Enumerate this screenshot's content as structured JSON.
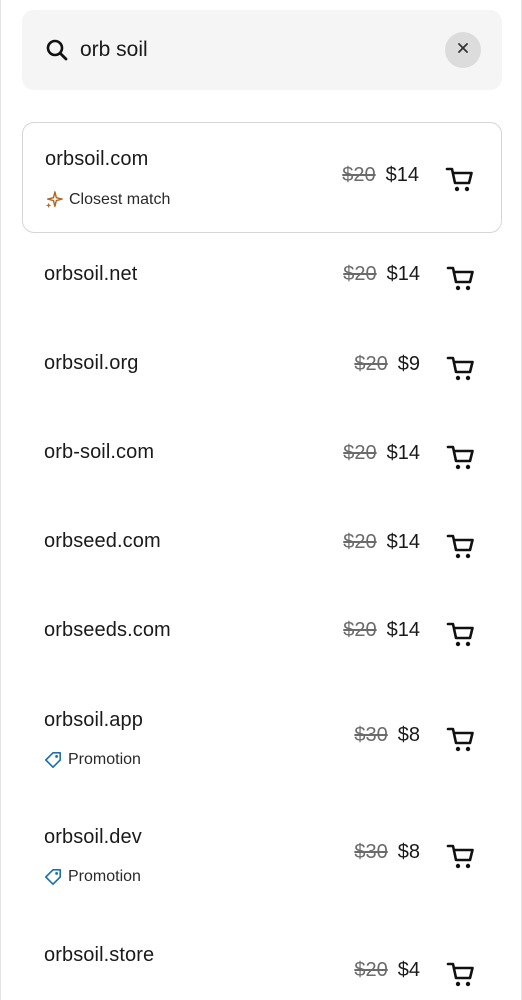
{
  "search": {
    "value": "orb soil"
  },
  "results": [
    {
      "domain": "orbsoil.com",
      "old_price": "$20",
      "price": "$14",
      "badge": "Closest match",
      "badge_type": "sparkle"
    },
    {
      "domain": "orbsoil.net",
      "old_price": "$20",
      "price": "$14"
    },
    {
      "domain": "orbsoil.org",
      "old_price": "$20",
      "price": "$9"
    },
    {
      "domain": "orb-soil.com",
      "old_price": "$20",
      "price": "$14"
    },
    {
      "domain": "orbseed.com",
      "old_price": "$20",
      "price": "$14"
    },
    {
      "domain": "orbseeds.com",
      "old_price": "$20",
      "price": "$14"
    },
    {
      "domain": "orbsoil.app",
      "old_price": "$30",
      "price": "$8",
      "badge": "Promotion",
      "badge_type": "tag"
    },
    {
      "domain": "orbsoil.dev",
      "old_price": "$30",
      "price": "$8",
      "badge": "Promotion",
      "badge_type": "tag"
    },
    {
      "domain": "orbsoil.store",
      "old_price": "$20",
      "price": "$4"
    }
  ],
  "colors": {
    "sparkle": "#b5661e",
    "tag": "#1a6fb5",
    "search_bg": "#f5f5f5"
  },
  "icons": {
    "search": "search-icon",
    "clear": "close-icon",
    "cart": "cart-icon",
    "sparkle": "sparkle-icon",
    "tag": "tag-icon"
  }
}
